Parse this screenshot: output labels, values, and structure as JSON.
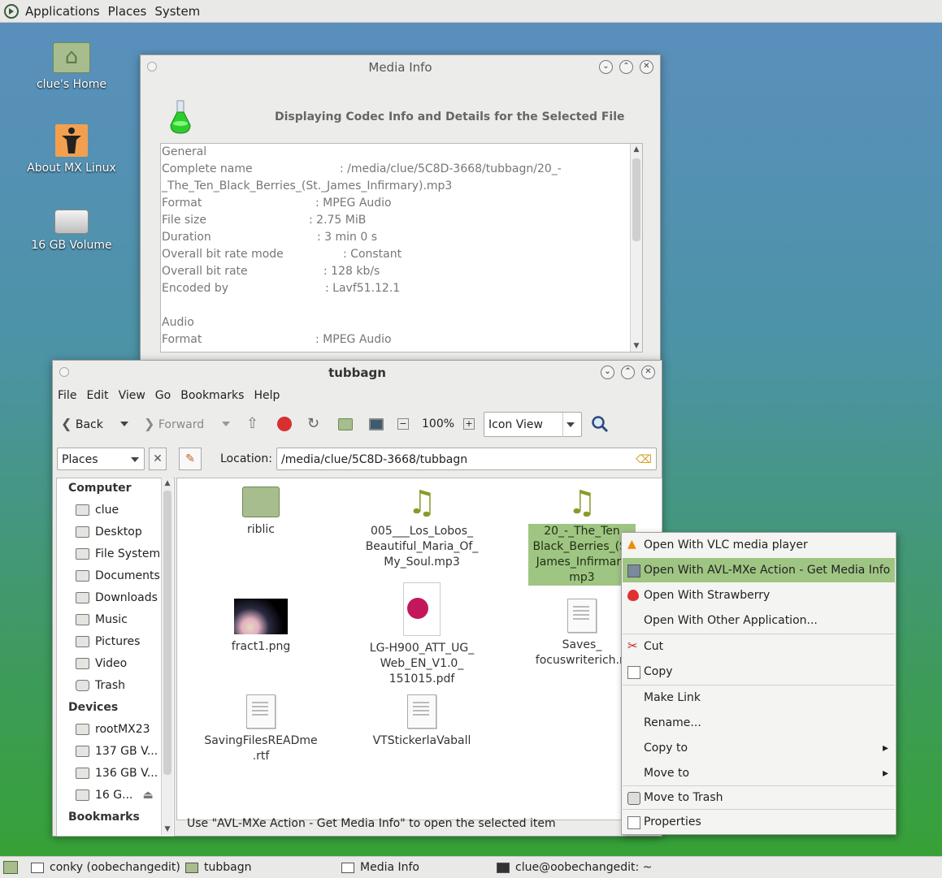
{
  "top_panel": {
    "menus": [
      "Applications",
      "Places",
      "System"
    ]
  },
  "desktop": {
    "icons": [
      {
        "label": "clue's Home",
        "icon": "home-folder-icon"
      },
      {
        "label": "About MX Linux",
        "icon": "about-icon"
      },
      {
        "label": "16 GB Volume",
        "icon": "drive-icon"
      }
    ]
  },
  "media_info": {
    "title": "Media Info",
    "heading": "Displaying Codec Info and Details for the Selected File",
    "lines": [
      {
        "label": "General",
        "value": ""
      },
      {
        "label": "Complete name",
        "value": ": /media/clue/5C8D-3668/tubbagn/20_-"
      },
      {
        "label": "_The_Ten_Black_Berries_(St._James_Infirmary).mp3",
        "value": ""
      },
      {
        "label": "Format",
        "value": ": MPEG Audio"
      },
      {
        "label": "File size",
        "value": ": 2.75 MiB"
      },
      {
        "label": "Duration",
        "value": ": 3 min 0 s"
      },
      {
        "label": "Overall bit rate mode",
        "value": ": Constant"
      },
      {
        "label": "Overall bit rate",
        "value": ": 128 kb/s"
      },
      {
        "label": "Encoded by",
        "value": ": Lavf51.12.1"
      },
      {
        "label": "",
        "value": ""
      },
      {
        "label": "Audio",
        "value": ""
      },
      {
        "label": "Format",
        "value": ": MPEG Audio"
      }
    ]
  },
  "file_manager": {
    "title": "tubbagn",
    "menu": [
      "File",
      "Edit",
      "View",
      "Go",
      "Bookmarks",
      "Help"
    ],
    "toolbar": {
      "back": "Back",
      "forward": "Forward",
      "zoom": "100%",
      "view_mode": "Icon View"
    },
    "side_pane_selector": "Places",
    "location_label": "Location:",
    "location_value": "/media/clue/5C8D-3668/tubbagn",
    "sidebar": {
      "computer_header": "Computer",
      "computer_items": [
        "clue",
        "Desktop",
        "File System",
        "Documents",
        "Downloads",
        "Music",
        "Pictures",
        "Video",
        "Trash"
      ],
      "devices_header": "Devices",
      "device_items": [
        "rootMX23",
        "137 GB V...",
        "136 GB V...",
        "16 G..."
      ],
      "bookmarks_header": "Bookmarks"
    },
    "files": [
      {
        "name": "riblic",
        "kind": "folder"
      },
      {
        "name": "005___Los_Lobos_ Beautiful_Maria_Of_ My_Soul.mp3",
        "kind": "audio"
      },
      {
        "name": "20_-_The_Ten Black_Berries_(St James_Infirmary mp3",
        "kind": "audio"
      },
      {
        "name": "fract1.png",
        "kind": "image"
      },
      {
        "name": "LG-H900_ATT_UG_ Web_EN_V1.0_ 151015.pdf",
        "kind": "pdf"
      },
      {
        "name": "Saves_ focuswriterich.rt",
        "kind": "document"
      },
      {
        "name": "SavingFilesREADme .rtf",
        "kind": "document"
      },
      {
        "name": "VTStickerlaVaball",
        "kind": "document"
      }
    ],
    "status": "Use \"AVL-MXe Action - Get Media Info\" to open the selected item"
  },
  "context_menu": {
    "items": [
      {
        "label": "Open With VLC media player",
        "icon": "vlc-icon"
      },
      {
        "label": "Open With AVL-MXe Action - Get Media Info",
        "icon": "media-info-icon"
      },
      {
        "label": "Open With Strawberry",
        "icon": "strawberry-icon"
      },
      {
        "label": "Open With Other Application...",
        "icon": ""
      },
      {
        "label": "Cut",
        "icon": "scissors-icon"
      },
      {
        "label": "Copy",
        "icon": "copy-icon"
      },
      {
        "label": "Make Link",
        "icon": ""
      },
      {
        "label": "Rename...",
        "icon": ""
      },
      {
        "label": "Copy to",
        "icon": ""
      },
      {
        "label": "Move to",
        "icon": ""
      },
      {
        "label": "Move to Trash",
        "icon": "trash-icon"
      },
      {
        "label": "Properties",
        "icon": "properties-icon"
      }
    ]
  },
  "taskbar": {
    "tasks": [
      "conky (oobechangedit)",
      "tubbagn",
      "Media Info",
      "clue@oobechangedit: ~"
    ]
  },
  "colors": {
    "selection": "#9fc583",
    "panel": "#e9e9e7"
  }
}
